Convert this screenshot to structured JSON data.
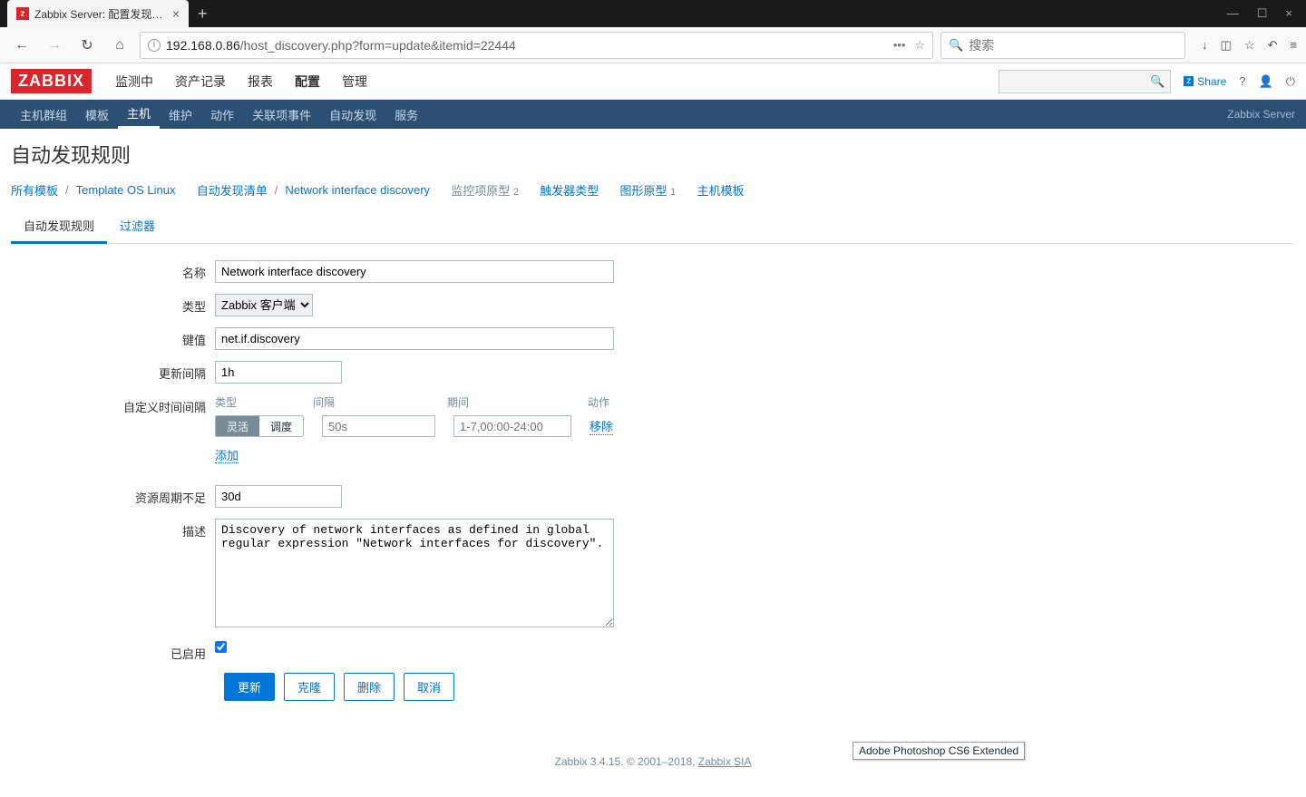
{
  "browser": {
    "tab_title": "Zabbix Server: 配置发现规则",
    "url_host": "192.168.0.86",
    "url_path": "/host_discovery.php?form=update&itemid=22444",
    "search_placeholder": "搜索"
  },
  "header": {
    "logo": "ZABBIX",
    "menu": [
      "监测中",
      "资产记录",
      "报表",
      "配置",
      "管理"
    ],
    "active_menu": "配置",
    "share": "Share",
    "server_label": "Zabbix Server"
  },
  "subnav": {
    "items": [
      "主机群组",
      "模板",
      "主机",
      "维护",
      "动作",
      "关联项事件",
      "自动发现",
      "服务"
    ],
    "active": "主机"
  },
  "page_title": "自动发现规则",
  "breadcrumb": {
    "all_templates": "所有模板",
    "template": "Template OS Linux",
    "discovery_list": "自动发现清单",
    "current": "Network interface discovery",
    "item_proto": "监控项原型",
    "item_proto_n": "2",
    "trigger_proto": "触发器类型",
    "graph_proto": "图形原型",
    "graph_proto_n": "1",
    "host_proto": "主机模板"
  },
  "tabs": {
    "rule": "自动发现规则",
    "filters": "过滤器"
  },
  "form": {
    "labels": {
      "name": "名称",
      "type": "类型",
      "key": "键值",
      "update": "更新间隔",
      "custom": "自定义时间间隔",
      "keep_lost": "资源周期不足",
      "description": "描述",
      "enabled": "已启用"
    },
    "name": "Network interface discovery",
    "type": "Zabbix 客户端",
    "key": "net.if.discovery",
    "update": "1h",
    "interval": {
      "head_type": "类型",
      "head_interval": "间隔",
      "head_period": "期间",
      "head_action": "动作",
      "flexible": "灵活",
      "scheduling": "调度",
      "interval_ph": "50s",
      "period_ph": "1-7,00:00-24:00",
      "remove": "移除",
      "add": "添加"
    },
    "keep_lost": "30d",
    "description": "Discovery of network interfaces as defined in global regular expression \"Network interfaces for discovery\".",
    "enabled": true
  },
  "buttons": {
    "update": "更新",
    "clone": "克隆",
    "delete": "删除",
    "cancel": "取消"
  },
  "footer": {
    "text": "Zabbix 3.4.15. © 2001–2018, ",
    "link": "Zabbix SIA"
  },
  "tooltip": "Adobe Photoshop CS6 Extended"
}
